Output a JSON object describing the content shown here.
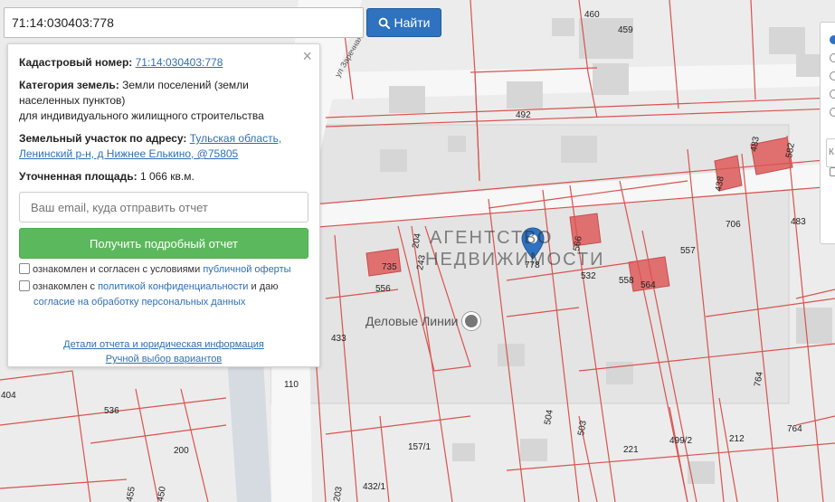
{
  "search": {
    "value": "71:14:030403:778",
    "button_label": "Найти"
  },
  "info": {
    "cadastral_label": "Кадастровый номер:",
    "cadastral_value": "71:14:030403:778",
    "category_label": "Категория земель:",
    "category_value_1": "Земли поселений (земли",
    "category_value_2": "населенных пунктов)",
    "category_value_3": "для индивидуального жилищного строительства",
    "address_label": "Земельный участок по адресу:",
    "address_value_1": "Тульская область,",
    "address_value_2": "Ленинский р-н, д Нижнее Елькино, @75805",
    "area_label": "Уточненная площадь:",
    "area_value": "1 066 кв.м.",
    "email_placeholder": "Ваш email, куда отправить отчет",
    "get_button": "Получить подробный отчет",
    "consent1_text": "ознакомлен и согласен с условиями",
    "consent1_link": "публичной оферты",
    "consent2_text": "ознакомлен с",
    "consent2_link": "политикой конфиденциальности",
    "consent2_mid": "и даю",
    "consent2_link2": "согласие на обработку персональных данных",
    "details_link": "Детали отчета и юридическая информация",
    "manual_link": "Ручной выбор вариантов"
  },
  "map": {
    "poi_label": "Деловые Линии",
    "street_label": "ул Заречная",
    "plot_numbers": [
      "460",
      "459",
      "492",
      "438",
      "483",
      "582",
      "706",
      "483",
      "557",
      "566",
      "532",
      "778",
      "558",
      "564",
      "735",
      "204",
      "243",
      "556",
      "433",
      "110",
      "404",
      "536",
      "200",
      "157/1",
      "432/1",
      "504",
      "503",
      "221",
      "499/2",
      "212",
      "764",
      "764",
      "455",
      "203",
      "450"
    ]
  },
  "watermark": {
    "logo": "ОСТ",
    "line1": "АГЕНТСТВО",
    "line2": "НЕДВИЖИМОСТИ"
  },
  "right_panel": {
    "input_text": "К"
  },
  "colors": {
    "parcel_line": "#d9534f",
    "building_fill": "#e07070",
    "road": "#f5f5f5",
    "accent": "#2f72bf",
    "green": "#5cb85c",
    "marker": "#2f72bf"
  }
}
